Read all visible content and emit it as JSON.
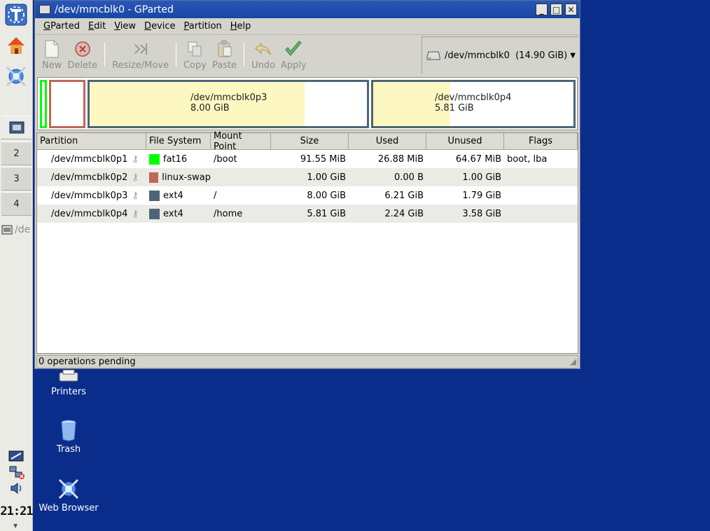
{
  "panel": {
    "desktops": [
      "2",
      "3",
      "4"
    ],
    "task_label": "/de",
    "clock": "21:21"
  },
  "desktop_icons": [
    {
      "label": "Printers",
      "icon": "printer-icon"
    },
    {
      "label": "Trash",
      "icon": "trash-icon"
    },
    {
      "label": "Web Browser",
      "icon": "web-browser-icon"
    }
  ],
  "window": {
    "title": "/dev/mmcblk0 - GParted",
    "menu": [
      {
        "pre": "",
        "u": "G",
        "post": "Parted"
      },
      {
        "pre": "",
        "u": "E",
        "post": "dit"
      },
      {
        "pre": "",
        "u": "V",
        "post": "iew"
      },
      {
        "pre": "",
        "u": "D",
        "post": "evice"
      },
      {
        "pre": "",
        "u": "P",
        "post": "artition"
      },
      {
        "pre": "",
        "u": "H",
        "post": "elp"
      }
    ],
    "toolbar": {
      "new": "New",
      "delete": "Delete",
      "resize": "Resize/Move",
      "copy": "Copy",
      "paste": "Paste",
      "undo": "Undo",
      "apply": "Apply"
    },
    "device": "/dev/mmcblk0  (14.90 GiB)",
    "diskmap": {
      "p3": {
        "name": "/dev/mmcblk0p3",
        "size": "8.00 GiB",
        "used_fraction": 0.776
      },
      "p4": {
        "name": "/dev/mmcblk0p4",
        "size": "5.81 GiB",
        "used_fraction": 0.385
      }
    },
    "columns": [
      "Partition",
      "File System",
      "Mount Point",
      "Size",
      "Used",
      "Unused",
      "Flags"
    ],
    "rows": [
      {
        "partition": "/dev/mmcblk0p1",
        "fs": "fat16",
        "color": "#00ff00",
        "mount": "/boot",
        "size": "91.55 MiB",
        "used": "26.88 MiB",
        "unused": "64.67 MiB",
        "flags": "boot, lba"
      },
      {
        "partition": "/dev/mmcblk0p2",
        "fs": "linux-swap",
        "color": "#c1665a",
        "mount": "",
        "size": "1.00 GiB",
        "used": "0.00 B",
        "unused": "1.00 GiB",
        "flags": ""
      },
      {
        "partition": "/dev/mmcblk0p3",
        "fs": "ext4",
        "color": "#4e6478",
        "mount": "/",
        "size": "8.00 GiB",
        "used": "6.21 GiB",
        "unused": "1.79 GiB",
        "flags": ""
      },
      {
        "partition": "/dev/mmcblk0p4",
        "fs": "ext4",
        "color": "#4e6478",
        "mount": "/home",
        "size": "5.81 GiB",
        "used": "2.24 GiB",
        "unused": "3.58 GiB",
        "flags": ""
      }
    ],
    "status": "0 operations pending"
  }
}
